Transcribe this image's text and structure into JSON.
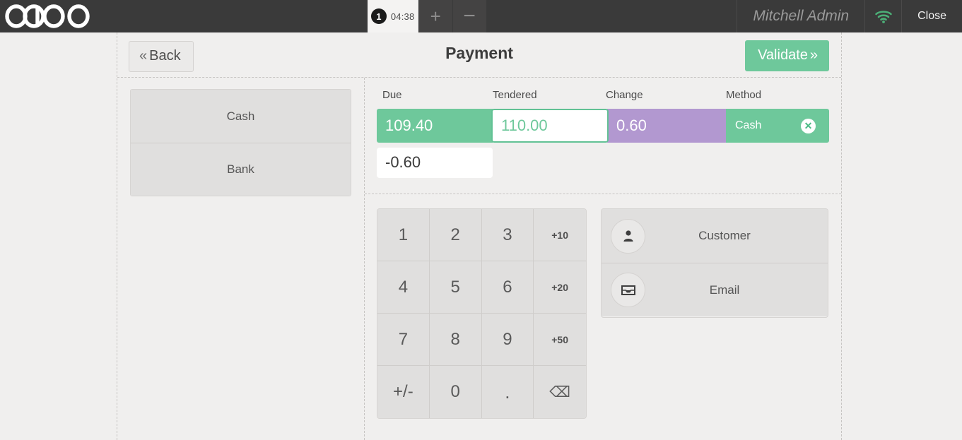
{
  "topbar": {
    "logo_text": "odoo",
    "order_tab": {
      "badge": "1",
      "timer": "04:38"
    },
    "add_label": "+",
    "remove_label": "−",
    "user_name": "Mitchell Admin",
    "wifi_icon": "wifi-icon",
    "close_label": "Close"
  },
  "header": {
    "back_label": "Back",
    "back_chevron": "«",
    "title": "Payment",
    "validate_label": "Validate",
    "validate_chevron": "»"
  },
  "payment_methods": [
    {
      "label": "Cash"
    },
    {
      "label": "Bank"
    }
  ],
  "lines": {
    "columns": {
      "due": "Due",
      "tendered": "Tendered",
      "change": "Change",
      "method": "Method"
    },
    "row": {
      "due": "109.40",
      "tendered": "110.00",
      "change": "0.60",
      "method": "Cash",
      "delete_icon": "close-circle-icon"
    },
    "remaining": "-0.60"
  },
  "numpad": [
    {
      "label": "1",
      "kind": "digit"
    },
    {
      "label": "2",
      "kind": "digit"
    },
    {
      "label": "3",
      "kind": "digit"
    },
    {
      "label": "+10",
      "kind": "small"
    },
    {
      "label": "4",
      "kind": "digit"
    },
    {
      "label": "5",
      "kind": "digit"
    },
    {
      "label": "6",
      "kind": "digit"
    },
    {
      "label": "+20",
      "kind": "small"
    },
    {
      "label": "7",
      "kind": "digit"
    },
    {
      "label": "8",
      "kind": "digit"
    },
    {
      "label": "9",
      "kind": "digit"
    },
    {
      "label": "+50",
      "kind": "small"
    },
    {
      "label": "+/-",
      "kind": "digit"
    },
    {
      "label": "0",
      "kind": "digit"
    },
    {
      "label": ".",
      "kind": "dot"
    },
    {
      "label": "⌫",
      "kind": "bksp"
    }
  ],
  "actions": [
    {
      "label": "Customer",
      "icon": "person-icon"
    },
    {
      "label": "Email",
      "icon": "inbox-icon"
    }
  ],
  "colors": {
    "green": "#6ec89b",
    "purple": "#b298d0",
    "topbar": "#3a3a3a",
    "panel": "#e0dfde",
    "page_bg": "#f0efee"
  }
}
